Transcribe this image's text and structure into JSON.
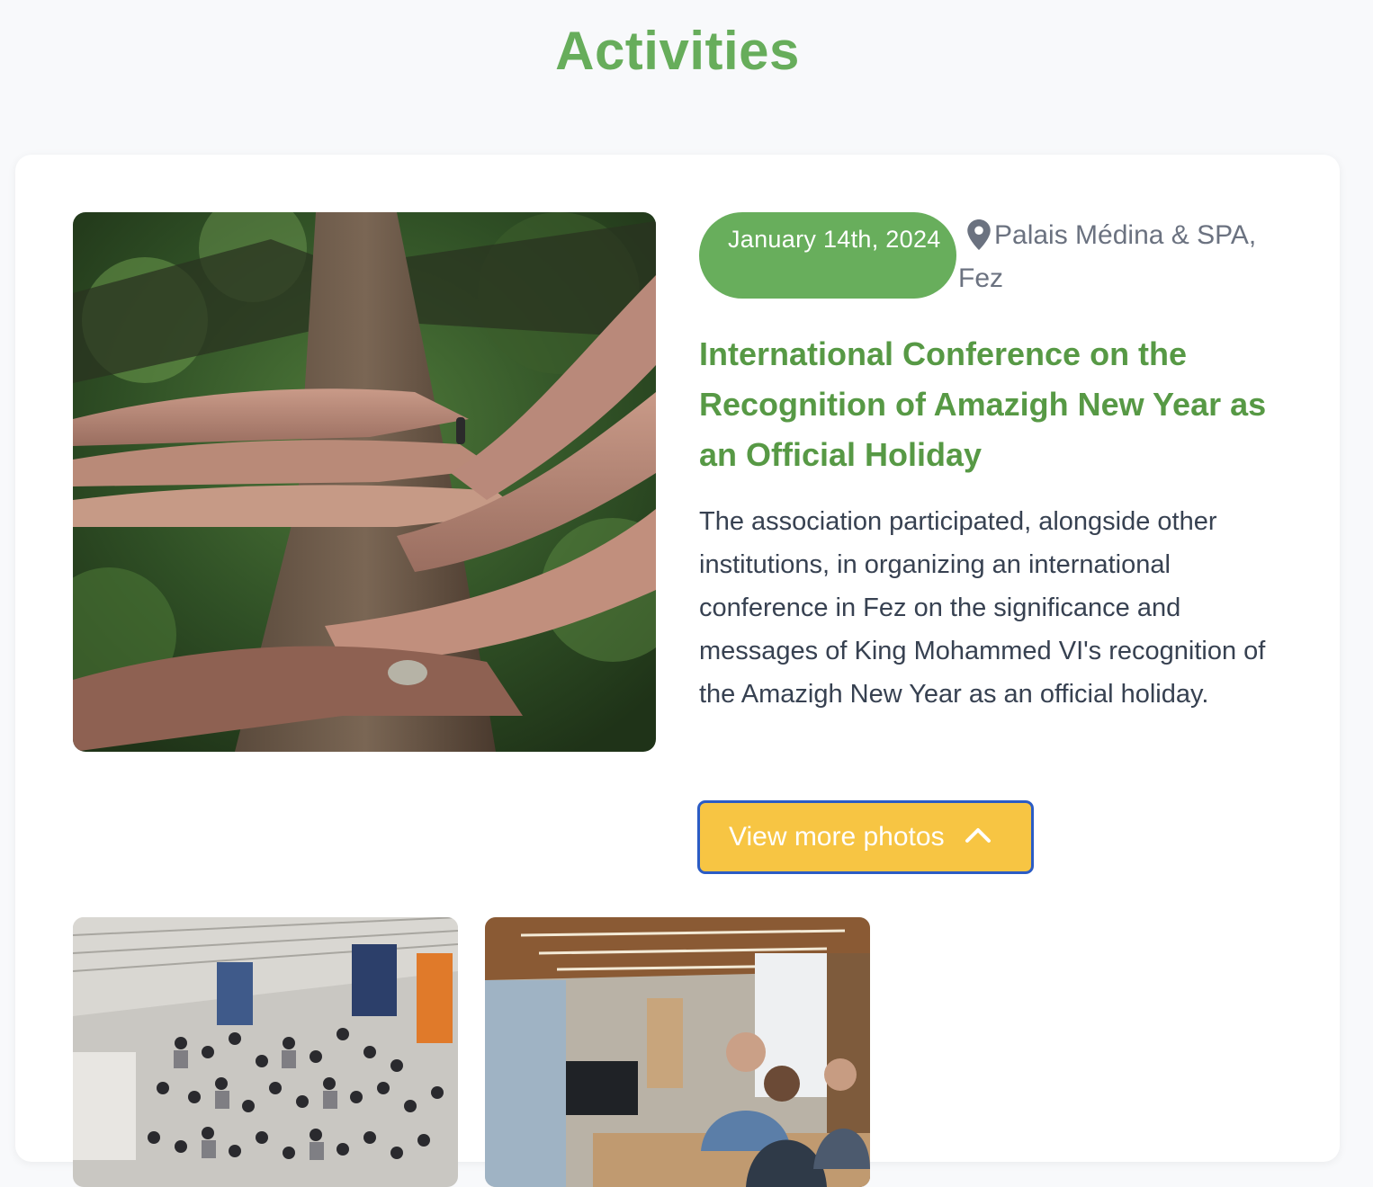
{
  "page": {
    "title": "Activities"
  },
  "activity": {
    "date": "January 14th, 2024",
    "location": "Palais Médina & SPA, Fez",
    "title": "International Conference on the Recognition of Amazigh New Year as an Official Holiday",
    "description": "The association participated, alongside other institutions, in organizing an international conference in Fez on the significance and messages of King Mohammed VI's recognition of the Amazigh New Year as an official holiday.",
    "button_label": "View more photos",
    "button_icon": "chevron-up-icon",
    "location_icon": "map-pin-icon"
  },
  "colors": {
    "accent_green": "#67ad5b",
    "button_yellow": "#f7c543",
    "button_border": "#2b5cc5"
  }
}
